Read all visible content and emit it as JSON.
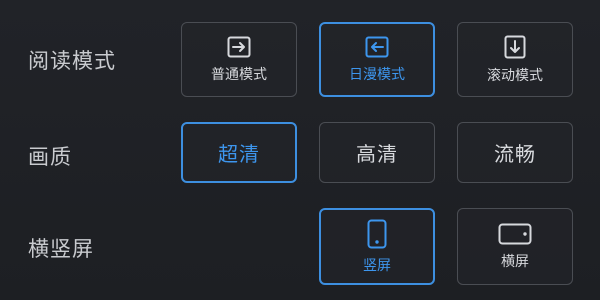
{
  "reading_mode": {
    "label": "阅读模式",
    "options": [
      {
        "label": "普通模式",
        "icon": "arrow-right-icon",
        "selected": false
      },
      {
        "label": "日漫模式",
        "icon": "arrow-left-icon",
        "selected": true
      },
      {
        "label": "滚动模式",
        "icon": "arrow-down-icon",
        "selected": false
      }
    ]
  },
  "quality": {
    "label": "画质",
    "options": [
      {
        "label": "超清",
        "selected": true
      },
      {
        "label": "高清",
        "selected": false
      },
      {
        "label": "流畅",
        "selected": false
      }
    ]
  },
  "orientation": {
    "label": "横竖屏",
    "options": [
      {
        "label": "竖屏",
        "icon": "portrait-phone-icon",
        "selected": true
      },
      {
        "label": "横屏",
        "icon": "landscape-phone-icon",
        "selected": false
      }
    ]
  },
  "colors": {
    "accent": "#3d8fe0",
    "border": "#4a4d53",
    "background": "#1f2125",
    "text": "#d7d9dd"
  }
}
